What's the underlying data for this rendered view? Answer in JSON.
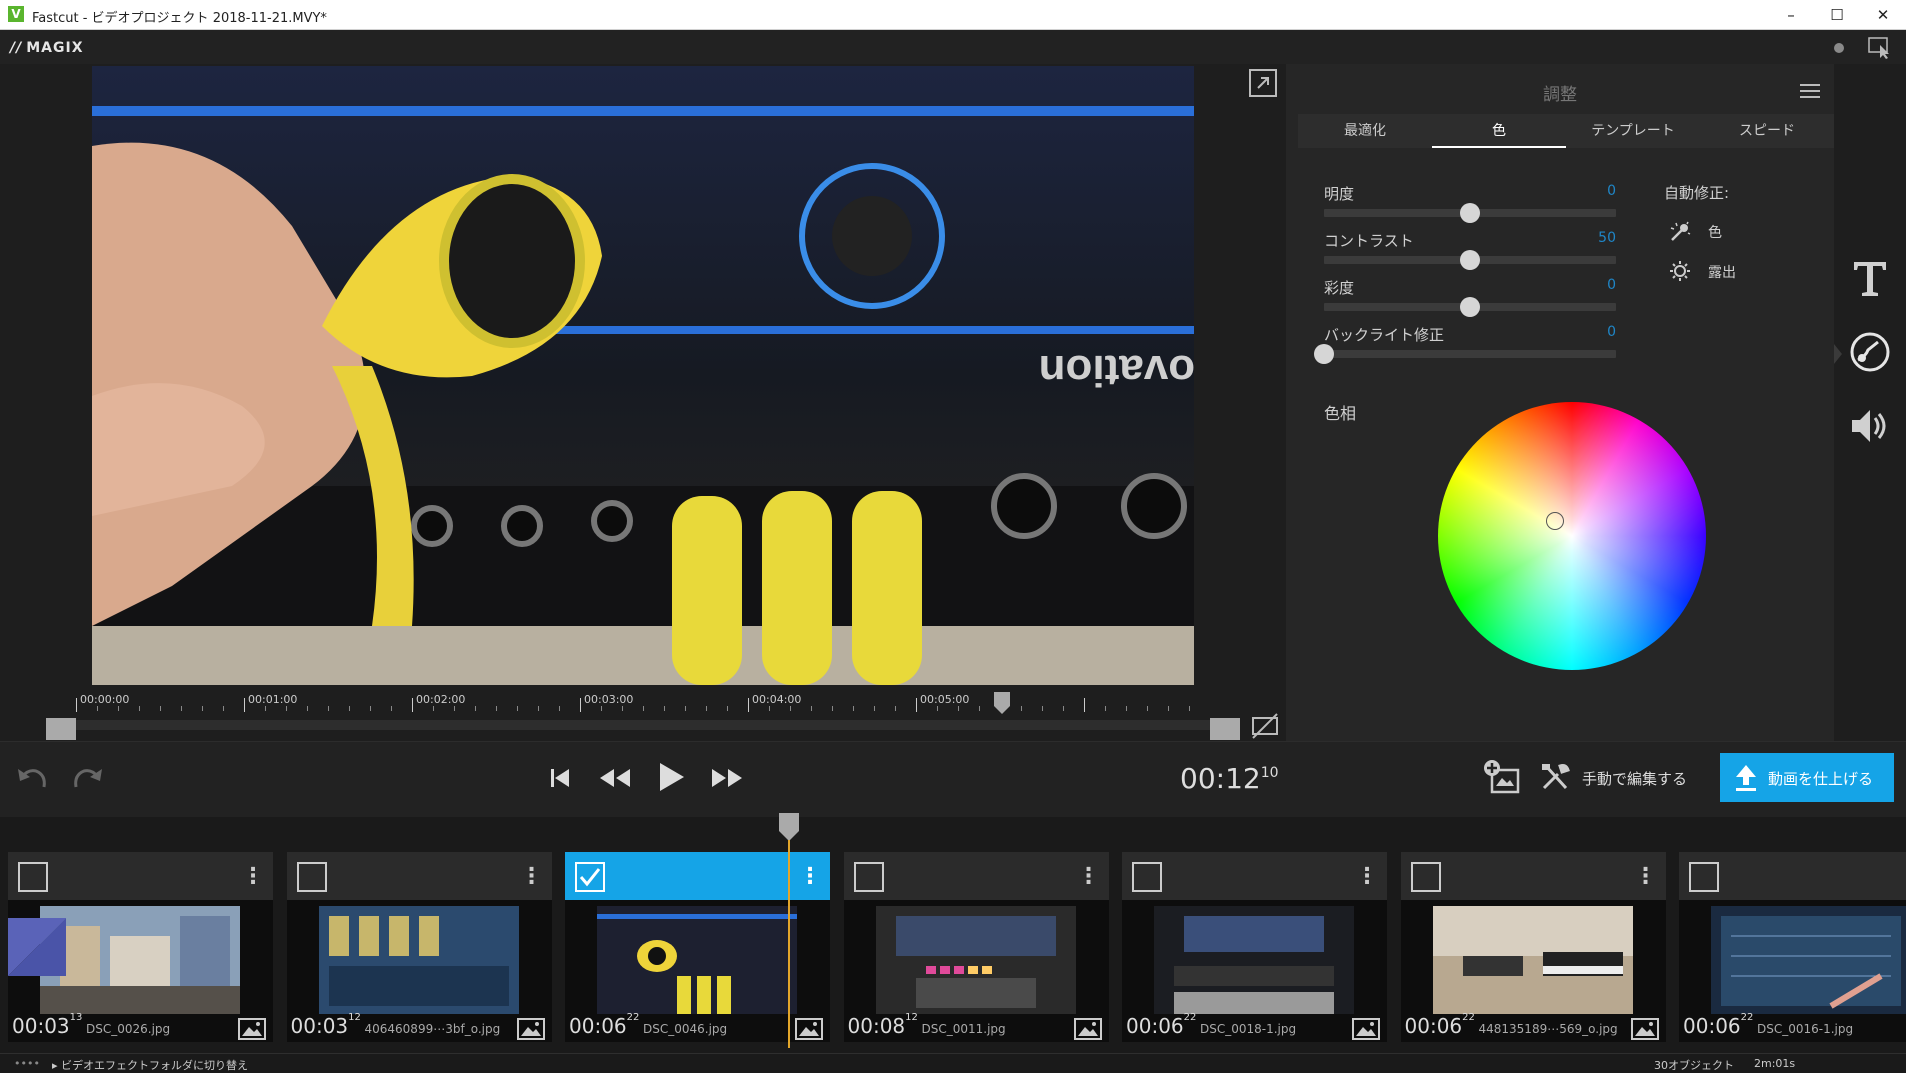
{
  "window": {
    "title": "Fastcut - ビデオプロジェクト 2018-11-21.MVY*",
    "min": "–",
    "max": "☐",
    "close": "✕"
  },
  "brand": "MAGIX",
  "timeline": {
    "labels": [
      "00:00:00",
      "00:01:00",
      "00:02:00",
      "00:03:00",
      "00:04:00",
      "00:05:00"
    ]
  },
  "panel": {
    "title": "調整",
    "tabs": [
      "最適化",
      "色",
      "テンプレート",
      "スピード"
    ],
    "active_tab": "色",
    "sliders": [
      {
        "label": "明度",
        "value": "0",
        "level": 0.5
      },
      {
        "label": "コントラスト",
        "value": "50",
        "level": 0.5
      },
      {
        "label": "彩度",
        "value": "0",
        "level": 0.5
      },
      {
        "label": "バックライト修正",
        "value": "0",
        "level": 0.0
      }
    ],
    "auto": {
      "label": "自動修正:",
      "color": "色",
      "exposure": "露出"
    },
    "hue_label": "色相"
  },
  "transport": {
    "timecode": "00:12",
    "frames": "10"
  },
  "actions": {
    "manual_edit": "手動で編集する",
    "finish": "動画を仕上げる"
  },
  "clips": [
    {
      "dur": "00:03",
      "frames": "13",
      "name": "DSC_0026.jpg",
      "selected": false
    },
    {
      "dur": "00:03",
      "frames": "12",
      "name": "406460899⋯3bf_o.jpg",
      "selected": false
    },
    {
      "dur": "00:06",
      "frames": "22",
      "name": "DSC_0046.jpg",
      "selected": true
    },
    {
      "dur": "00:08",
      "frames": "12",
      "name": "DSC_0011.jpg",
      "selected": false
    },
    {
      "dur": "00:06",
      "frames": "22",
      "name": "DSC_0018-1.jpg",
      "selected": false
    },
    {
      "dur": "00:06",
      "frames": "22",
      "name": "448135189⋯569_o.jpg",
      "selected": false
    },
    {
      "dur": "00:06",
      "frames": "22",
      "name": "DSC_0016-1.jpg",
      "selected": false
    }
  ],
  "status": {
    "dots": "••••",
    "switch": "▸ ビデオエフェクトフォルダに切り替え",
    "objects": "30オブジェクト",
    "length": "2m:01s"
  },
  "colors": {
    "accent": "#15a4e7",
    "playhead": "#e3a62a",
    "slider_value": "#1f86c7"
  }
}
